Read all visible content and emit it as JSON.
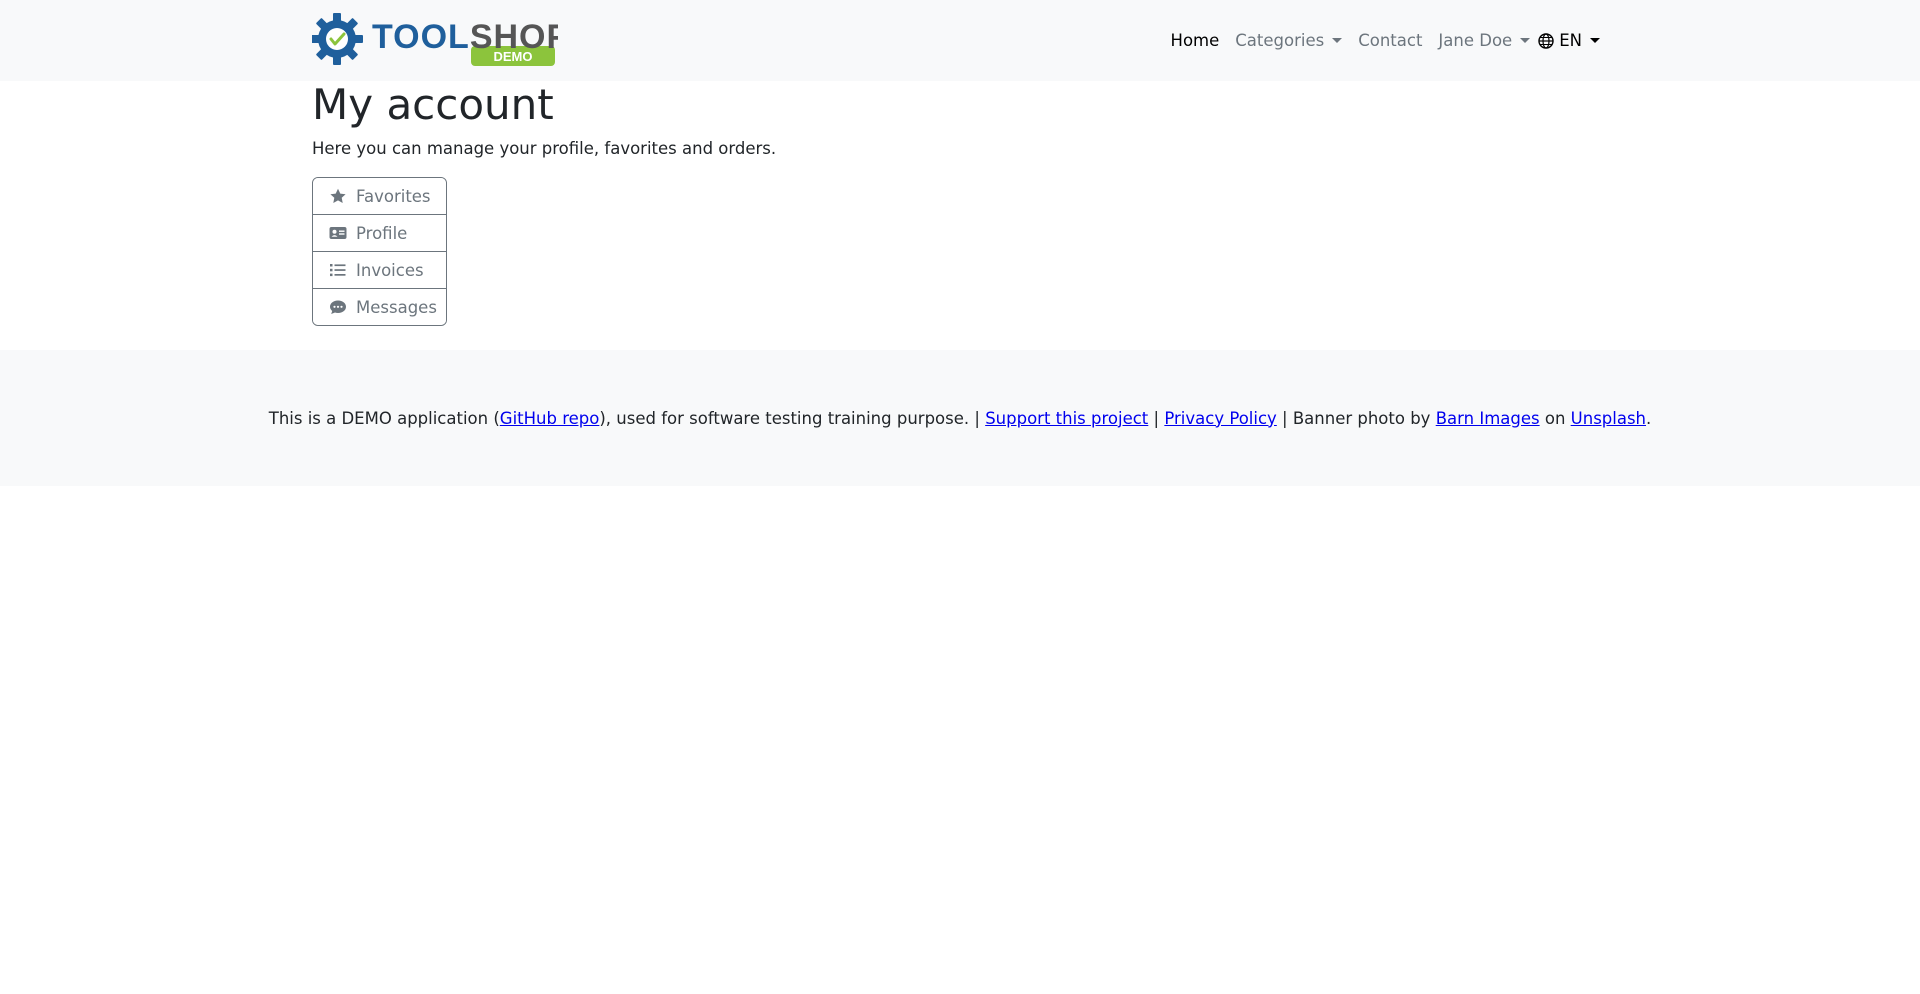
{
  "header": {
    "logo_text_tool": "TOOL",
    "logo_text_shop": "SHOP",
    "logo_badge": "DEMO",
    "nav": {
      "home": "Home",
      "categories": "Categories",
      "contact": "Contact",
      "user": "Jane Doe",
      "language": "EN"
    }
  },
  "main": {
    "title": "My account",
    "subtitle": "Here you can manage your profile, favorites and orders.",
    "menu": [
      {
        "label": "Favorites",
        "icon": "star-icon"
      },
      {
        "label": "Profile",
        "icon": "id-card-icon"
      },
      {
        "label": "Invoices",
        "icon": "list-icon"
      },
      {
        "label": "Messages",
        "icon": "comment-icon"
      }
    ]
  },
  "footer": {
    "text_1": "This is a DEMO application (",
    "github_link": "GitHub repo",
    "text_2": "), used for software testing training purpose. | ",
    "support_link": "Support this project",
    "text_3": " | ",
    "privacy_link": "Privacy Policy",
    "text_4": " | Banner photo by ",
    "barn_link": "Barn Images",
    "text_5": " on ",
    "unsplash_link": "Unsplash",
    "text_6": "."
  },
  "colors": {
    "navbar_bg": "#f8f9fa",
    "logo_blue": "#1f5f9c",
    "logo_gray": "#555555",
    "logo_green": "#8cc43c",
    "muted": "#6c757d",
    "link": "#0000ee"
  }
}
